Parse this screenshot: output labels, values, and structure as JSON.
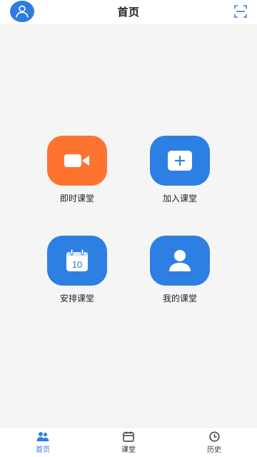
{
  "header": {
    "title": "首页",
    "avatar_icon": "user-avatar-icon",
    "scan_icon": "scan-icon"
  },
  "tiles": [
    {
      "label": "即时课堂",
      "icon": "video-camera-icon",
      "color": "#ff7330"
    },
    {
      "label": "加入课堂",
      "icon": "plus-square-icon",
      "color": "#2e7fe3"
    },
    {
      "label": "安排课堂",
      "icon": "calendar-icon",
      "color": "#2e7fe3",
      "icon_text": "10"
    },
    {
      "label": "我的课堂",
      "icon": "person-icon",
      "color": "#2e7fe3"
    }
  ],
  "bottom_nav": [
    {
      "label": "首页",
      "icon": "home-people-icon",
      "active": true
    },
    {
      "label": "课堂",
      "icon": "calendar-tab-icon",
      "active": false
    },
    {
      "label": "历史",
      "icon": "clock-icon",
      "active": false
    }
  ],
  "colors": {
    "accent": "#2e7fe3",
    "orange": "#ff7330",
    "background": "#f5f5f5"
  }
}
